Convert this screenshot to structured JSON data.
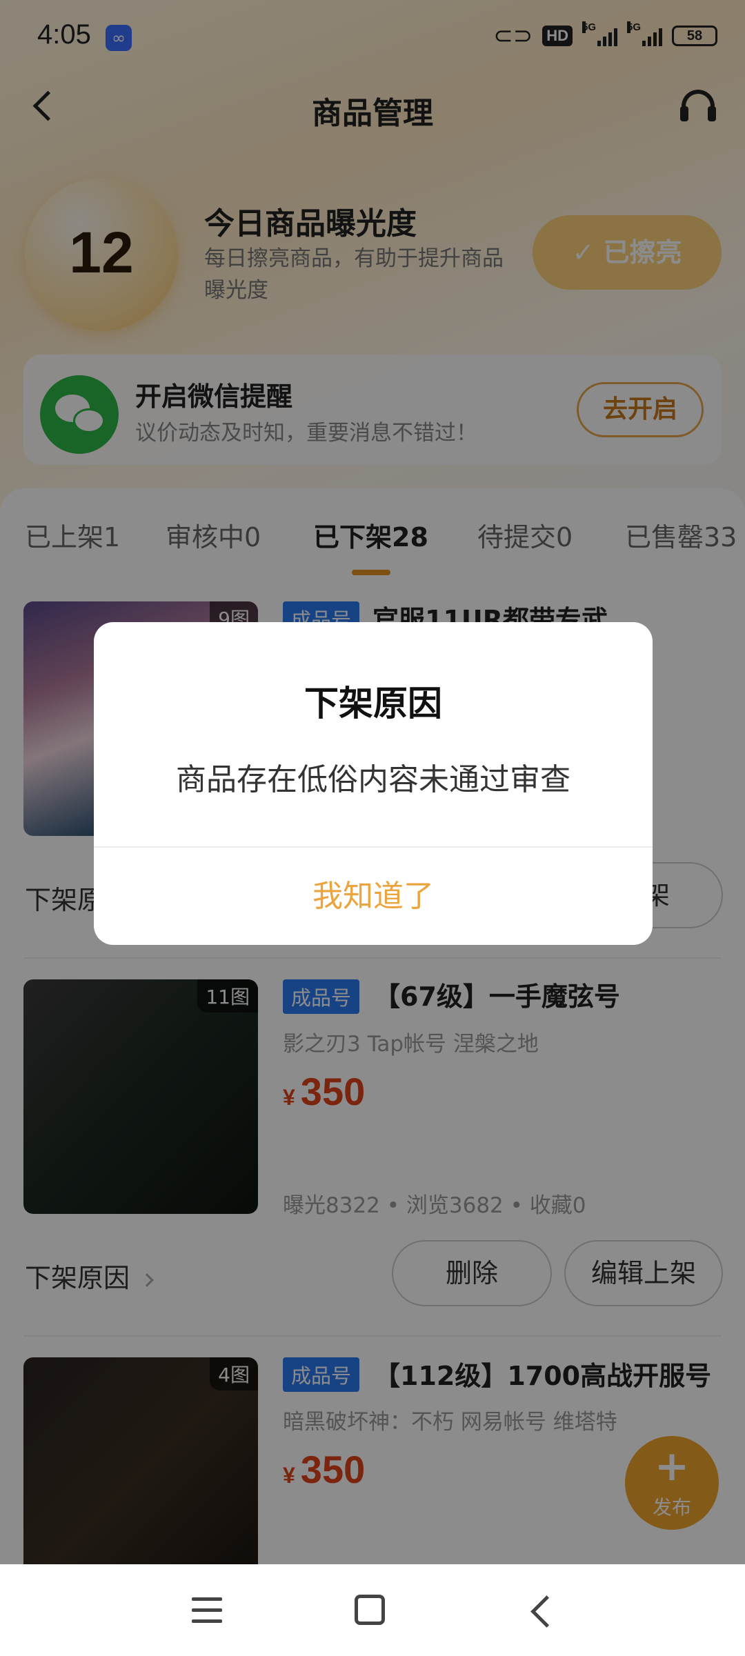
{
  "status_bar": {
    "time": "4:05",
    "hd": "HD",
    "net1": "5G",
    "net2": "5G",
    "battery": "58"
  },
  "header": {
    "title": "商品管理"
  },
  "exposure": {
    "count": "12",
    "title": "今日商品曝光度",
    "description": "每日擦亮商品，有助于提升商品曝光度",
    "polish_button": "✓ 已擦亮"
  },
  "wechat": {
    "title": "开启微信提醒",
    "description": "议价动态及时知，重要消息不错过！",
    "open_button": "去开启"
  },
  "tabs": [
    {
      "label": "已上架1"
    },
    {
      "label": "审核中0"
    },
    {
      "label": "已下架28",
      "active": true
    },
    {
      "label": "待提交0"
    },
    {
      "label": "已售罄33"
    }
  ],
  "items": [
    {
      "image_count": "9图",
      "badge": "成品号",
      "title": "官服11UR都带专武",
      "reason_label": "下架原",
      "relist_button": "上架"
    },
    {
      "image_count": "11图",
      "badge": "成品号",
      "title": "【67级】一手魔弦号",
      "tags": "影之刃3  Tap帐号  涅槃之地",
      "currency": "¥",
      "price": "350",
      "stats": "曝光8322 • 浏览3682 • 收藏0",
      "reason_label": "下架原因",
      "delete_button": "删除",
      "relist_button": "编辑上架"
    },
    {
      "image_count": "4图",
      "badge": "成品号",
      "title": "【112级】1700高战开服号",
      "tags": "暗黑破坏神：不朽  网易帐号  维塔特",
      "currency": "¥",
      "price": "350"
    }
  ],
  "fab": {
    "plus": "+",
    "label": "发布"
  },
  "dialog": {
    "title": "下架原因",
    "message": "商品存在低俗内容未通过审查",
    "ok_button": "我知道了"
  }
}
